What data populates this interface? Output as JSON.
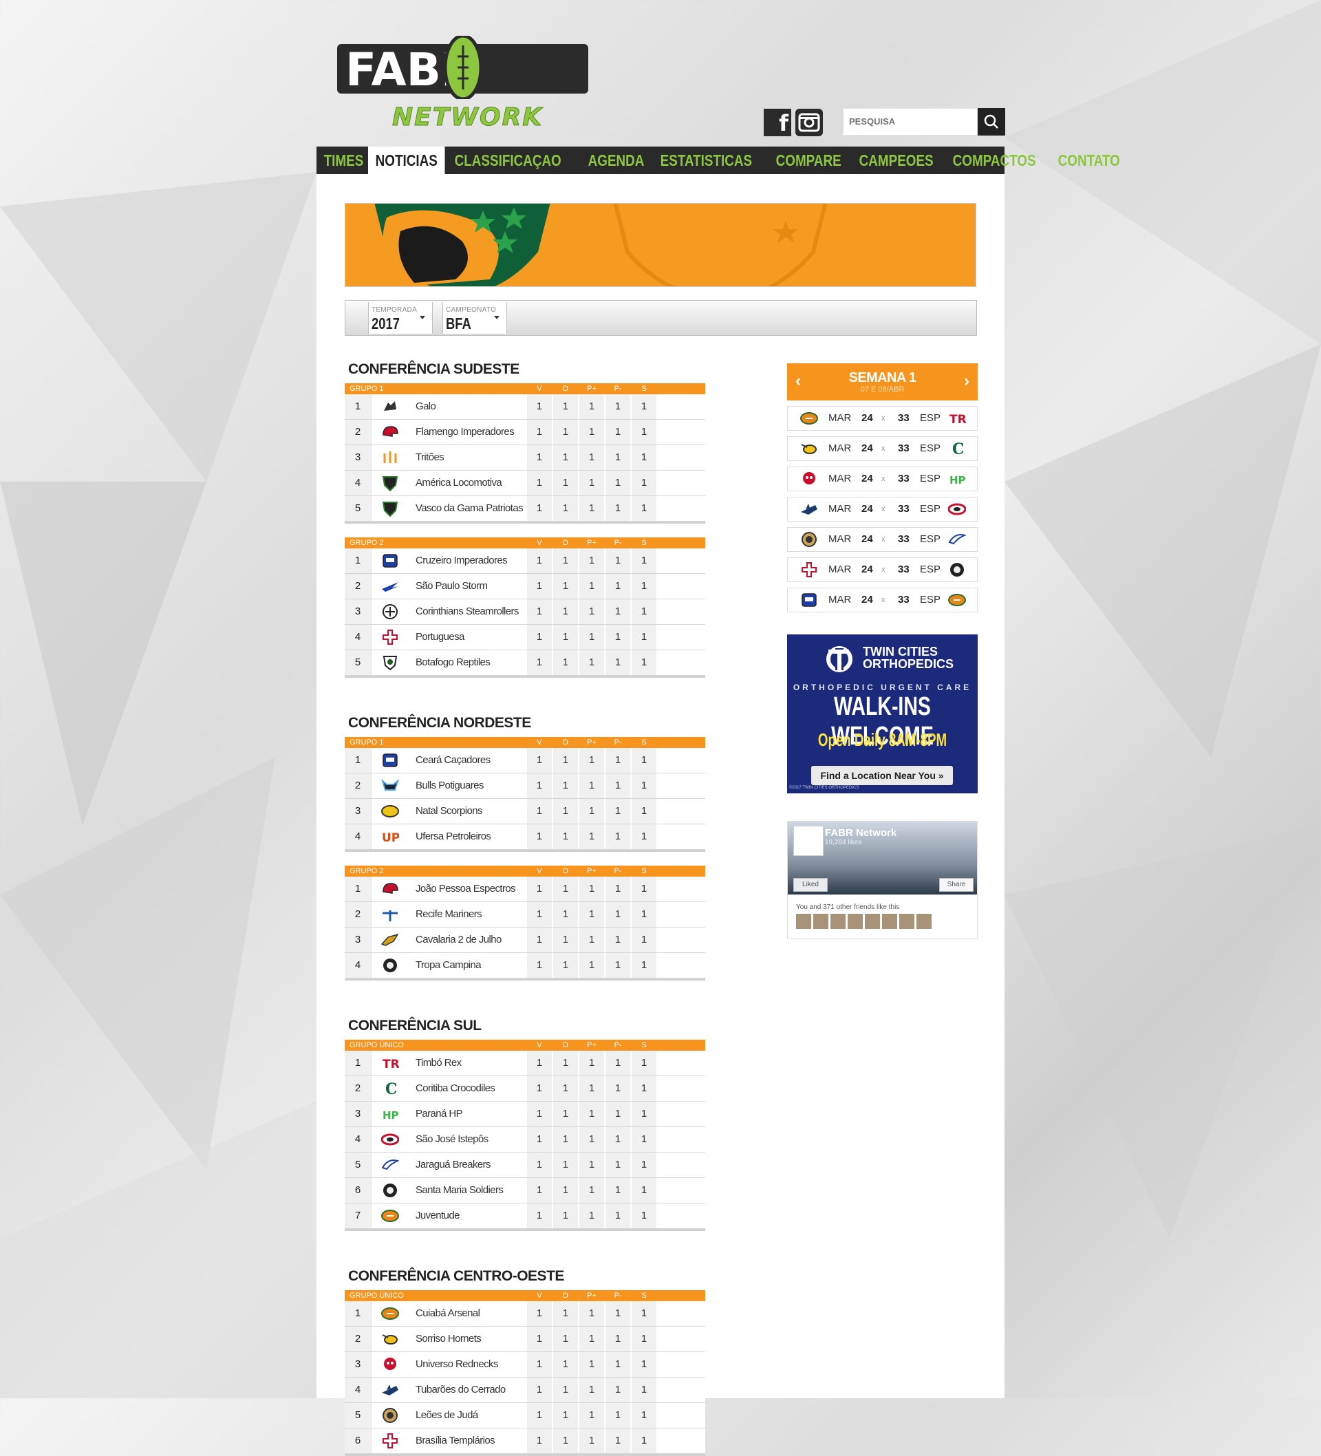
{
  "header": {
    "logo_top": "FABR",
    "logo_sub": "NETWORK",
    "search_placeholder": "PESQUISA"
  },
  "nav": [
    "TIMES",
    "NOTICIAS",
    "CLASSIFICAÇAO",
    "AGENDA",
    "ESTATISTICAS",
    "COMPARE",
    "CAMPEOES",
    "COMPACTOS",
    "CONTATO"
  ],
  "nav_active": "NOTICIAS",
  "colors": {
    "accent": "#f7941d",
    "brand_green": "#8dc63f",
    "nav_bg": "#2a2a2a"
  },
  "filters": {
    "season_label": "TEMPORADA",
    "season_value": "2017",
    "champ_label": "CAMPEONATO",
    "champ_value": "BFA"
  },
  "columns": [
    "V",
    "D",
    "P+",
    "P-",
    "S"
  ],
  "conferences": [
    {
      "title": "CONFERÊNCIA SUDESTE",
      "groups": [
        {
          "name": "GRUPO 1",
          "rows": [
            {
              "pos": "1",
              "team": "Galo",
              "icon": "rooster-icon",
              "stats": [
                "1",
                "1",
                "1",
                "1",
                "1"
              ]
            },
            {
              "pos": "2",
              "team": "Flamengo Imperadores",
              "icon": "helmet-icon",
              "stats": [
                "1",
                "1",
                "1",
                "1",
                "1"
              ]
            },
            {
              "pos": "3",
              "team": "Tritões",
              "icon": "trident-icon",
              "stats": [
                "1",
                "1",
                "1",
                "1",
                "1"
              ]
            },
            {
              "pos": "4",
              "team": "América Locomotiva",
              "icon": "shield-icon",
              "stats": [
                "1",
                "1",
                "1",
                "1",
                "1"
              ]
            },
            {
              "pos": "5",
              "team": "Vasco da Gama Patriotas",
              "icon": "shield-icon",
              "stats": [
                "1",
                "1",
                "1",
                "1",
                "1"
              ]
            }
          ]
        },
        {
          "name": "GRUPO 2",
          "rows": [
            {
              "pos": "1",
              "team": "Cruzeiro Imperadores",
              "icon": "badge-icon",
              "stats": [
                "1",
                "1",
                "1",
                "1",
                "1"
              ]
            },
            {
              "pos": "2",
              "team": "São Paulo Storm",
              "icon": "wing-icon",
              "stats": [
                "1",
                "1",
                "1",
                "1",
                "1"
              ]
            },
            {
              "pos": "3",
              "team": "Corinthians Steamrollers",
              "icon": "crest-icon",
              "stats": [
                "1",
                "1",
                "1",
                "1",
                "1"
              ]
            },
            {
              "pos": "4",
              "team": "Portuguesa",
              "icon": "cross-icon",
              "stats": [
                "1",
                "1",
                "1",
                "1",
                "1"
              ]
            },
            {
              "pos": "5",
              "team": "Botafogo Reptiles",
              "icon": "star-shield-icon",
              "stats": [
                "1",
                "1",
                "1",
                "1",
                "1"
              ]
            }
          ]
        }
      ]
    },
    {
      "title": "CONFERÊNCIA NORDESTE",
      "groups": [
        {
          "name": "GRUPO 1",
          "rows": [
            {
              "pos": "1",
              "team": "Ceará Caçadores",
              "icon": "badge-icon",
              "stats": [
                "1",
                "1",
                "1",
                "1",
                "1"
              ]
            },
            {
              "pos": "2",
              "team": "Bulls Potiguares",
              "icon": "bull-icon",
              "stats": [
                "1",
                "1",
                "1",
                "1",
                "1"
              ]
            },
            {
              "pos": "3",
              "team": "Natal Scorpions",
              "icon": "scorpion-icon",
              "stats": [
                "1",
                "1",
                "1",
                "1",
                "1"
              ]
            },
            {
              "pos": "4",
              "team": "Ufersa Petroleiros",
              "icon": "up-icon",
              "stats": [
                "1",
                "1",
                "1",
                "1",
                "1"
              ]
            }
          ]
        },
        {
          "name": "GRUPO 2",
          "rows": [
            {
              "pos": "1",
              "team": "João Pessoa Espectros",
              "icon": "helmet-icon",
              "stats": [
                "1",
                "1",
                "1",
                "1",
                "1"
              ]
            },
            {
              "pos": "2",
              "team": "Recife Mariners",
              "icon": "anchor-icon",
              "stats": [
                "1",
                "1",
                "1",
                "1",
                "1"
              ]
            },
            {
              "pos": "3",
              "team": "Cavalaria 2 de Julho",
              "icon": "horse-icon",
              "stats": [
                "1",
                "1",
                "1",
                "1",
                "1"
              ]
            },
            {
              "pos": "4",
              "team": "Tropa Campina",
              "icon": "soldier-icon",
              "stats": [
                "1",
                "1",
                "1",
                "1",
                "1"
              ]
            }
          ]
        }
      ]
    },
    {
      "title": "CONFERÊNCIA SUL",
      "groups": [
        {
          "name": "GRUPO ÚNICO",
          "rows": [
            {
              "pos": "1",
              "team": "Timbó Rex",
              "icon": "tr-icon",
              "stats": [
                "1",
                "1",
                "1",
                "1",
                "1"
              ]
            },
            {
              "pos": "2",
              "team": "Coritiba Crocodiles",
              "icon": "c-icon",
              "stats": [
                "1",
                "1",
                "1",
                "1",
                "1"
              ]
            },
            {
              "pos": "3",
              "team": "Paraná HP",
              "icon": "hp-icon",
              "stats": [
                "1",
                "1",
                "1",
                "1",
                "1"
              ]
            },
            {
              "pos": "4",
              "team": "São José Istepôs",
              "icon": "oval-icon",
              "stats": [
                "1",
                "1",
                "1",
                "1",
                "1"
              ]
            },
            {
              "pos": "5",
              "team": "Jaraguá Breakers",
              "icon": "wave-icon",
              "stats": [
                "1",
                "1",
                "1",
                "1",
                "1"
              ]
            },
            {
              "pos": "6",
              "team": "Santa Maria Soldiers",
              "icon": "soldier-icon",
              "stats": [
                "1",
                "1",
                "1",
                "1",
                "1"
              ]
            },
            {
              "pos": "7",
              "team": "Juventude",
              "icon": "ball-icon",
              "stats": [
                "1",
                "1",
                "1",
                "1",
                "1"
              ]
            }
          ]
        }
      ]
    },
    {
      "title": "CONFERÊNCIA CENTRO-OESTE",
      "groups": [
        {
          "name": "GRUPO ÚNICO",
          "rows": [
            {
              "pos": "1",
              "team": "Cuiabá Arsenal",
              "icon": "ball-icon",
              "stats": [
                "1",
                "1",
                "1",
                "1",
                "1"
              ]
            },
            {
              "pos": "2",
              "team": "Sorriso Hornets",
              "icon": "hornet-icon",
              "stats": [
                "1",
                "1",
                "1",
                "1",
                "1"
              ]
            },
            {
              "pos": "3",
              "team": "Universo Rednecks",
              "icon": "skull-icon",
              "stats": [
                "1",
                "1",
                "1",
                "1",
                "1"
              ]
            },
            {
              "pos": "4",
              "team": "Tubarões do Cerrado",
              "icon": "shark-icon",
              "stats": [
                "1",
                "1",
                "1",
                "1",
                "1"
              ]
            },
            {
              "pos": "5",
              "team": "Leões de Judá",
              "icon": "lion-icon",
              "stats": [
                "1",
                "1",
                "1",
                "1",
                "1"
              ]
            },
            {
              "pos": "6",
              "team": "Brasília Templários",
              "icon": "cross-icon",
              "stats": [
                "1",
                "1",
                "1",
                "1",
                "1"
              ]
            }
          ]
        }
      ]
    }
  ],
  "week": {
    "title": "SEMANA 1",
    "subtitle": "07 E 08/ABR",
    "prev": "‹",
    "next": "›",
    "games": [
      {
        "home": "MAR",
        "home_score": "24",
        "sep": "x",
        "away_score": "33",
        "away": "ESP",
        "home_icon": "ball-icon",
        "away_icon": "tr-icon"
      },
      {
        "home": "MAR",
        "home_score": "24",
        "sep": "x",
        "away_score": "33",
        "away": "ESP",
        "home_icon": "hornet-icon",
        "away_icon": "c-icon"
      },
      {
        "home": "MAR",
        "home_score": "24",
        "sep": "x",
        "away_score": "33",
        "away": "ESP",
        "home_icon": "skull-icon",
        "away_icon": "hp-icon"
      },
      {
        "home": "MAR",
        "home_score": "24",
        "sep": "x",
        "away_score": "33",
        "away": "ESP",
        "home_icon": "shark-icon",
        "away_icon": "oval-icon"
      },
      {
        "home": "MAR",
        "home_score": "24",
        "sep": "x",
        "away_score": "33",
        "away": "ESP",
        "home_icon": "lion-icon",
        "away_icon": "wave-icon"
      },
      {
        "home": "MAR",
        "home_score": "24",
        "sep": "x",
        "away_score": "33",
        "away": "ESP",
        "home_icon": "cross-icon",
        "away_icon": "soldier-icon"
      },
      {
        "home": "MAR",
        "home_score": "24",
        "sep": "x",
        "away_score": "33",
        "away": "ESP",
        "home_icon": "badge-icon",
        "away_icon": "ball-icon"
      }
    ]
  },
  "ad": {
    "brand": "TWIN CITIES ORTHOPEDICS",
    "line1": "ORTHOPEDIC URGENT CARE",
    "line2": "WALK-INS WELCOME",
    "line3": "Open Daily 8AM-8PM",
    "button": "Find a Location Near You »",
    "fine": "©2017 TWIN CITIES ORTHOPEDICS"
  },
  "facebook": {
    "name": "FABR Network",
    "likes": "19,284 likes",
    "liked": "Liked",
    "share": "Share",
    "friends": "You and 371 other friends like this"
  }
}
